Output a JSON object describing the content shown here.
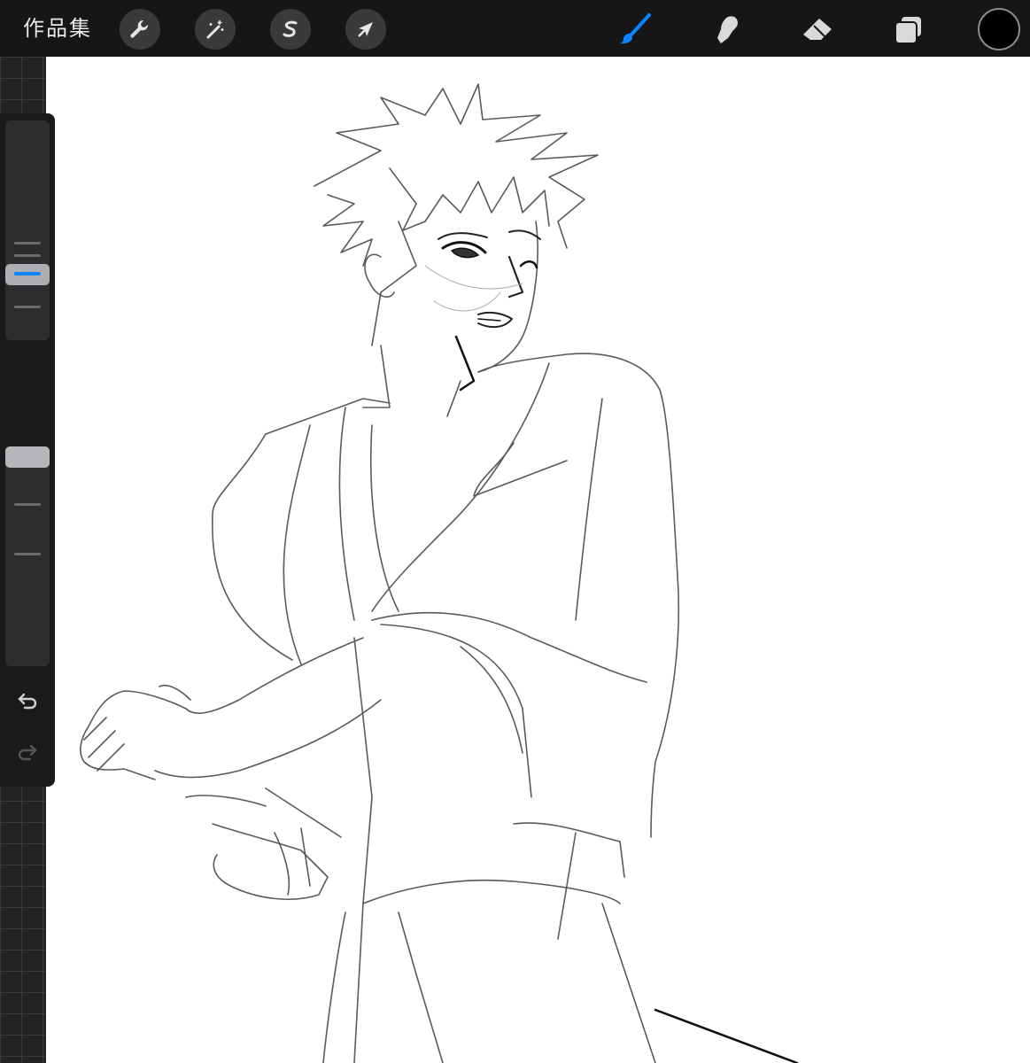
{
  "toolbar": {
    "gallery_label": "作品集",
    "left_tools": [
      {
        "name": "wrench-icon"
      },
      {
        "name": "magic-wand-icon"
      },
      {
        "name": "selection-s-icon"
      },
      {
        "name": "transform-arrow-icon"
      }
    ],
    "right_tools": [
      {
        "name": "brush-icon",
        "active": true,
        "color": "#0a84ff"
      },
      {
        "name": "smudge-icon"
      },
      {
        "name": "eraser-icon"
      },
      {
        "name": "layers-icon"
      }
    ],
    "current_color": "#000000"
  },
  "sidebar": {
    "brush_size_slider": {
      "level": 0.75
    },
    "opacity_slider": {
      "level": 0.98
    },
    "buttons": [
      "modify-square-icon",
      "undo-icon",
      "redo-icon"
    ]
  },
  "colors": {
    "accent": "#0a84ff",
    "toolbar_bg": "#161617",
    "canvas_bg": "#ffffff"
  }
}
